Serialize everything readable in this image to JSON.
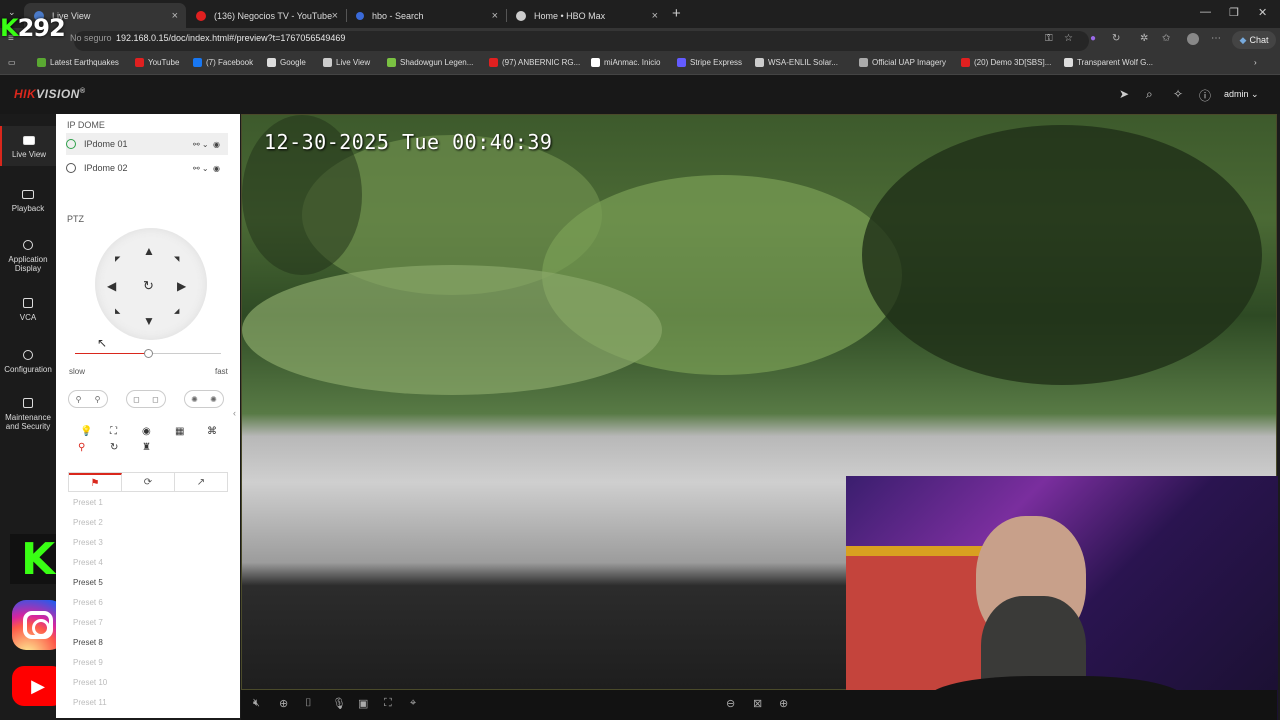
{
  "browser": {
    "tabs": [
      {
        "label": "Live View",
        "active": true,
        "color": "#4a7ac8"
      },
      {
        "label": "(136) Negocios TV - YouTube",
        "active": false,
        "color": "#e02020"
      },
      {
        "label": "hbo - Search",
        "active": false,
        "color": "#3a6ad8"
      },
      {
        "label": "Home • HBO Max",
        "active": false,
        "color": "#cccccc"
      }
    ],
    "insecure_label": "No seguro",
    "url": "192.168.0.15/doc/index.html#/preview?t=1767056549469",
    "chat_label": "Chat",
    "bookmarks": [
      {
        "label": "Latest Earthquakes",
        "color": "#5aa832"
      },
      {
        "label": "YouTube",
        "color": "#e02020"
      },
      {
        "label": "(7) Facebook",
        "color": "#1877f2"
      },
      {
        "label": "Google",
        "color": "#dddddd"
      },
      {
        "label": "Live View",
        "color": "#cccccc"
      },
      {
        "label": "Shadowgun Legen...",
        "color": "#7ac142"
      },
      {
        "label": "(97) ANBERNIC RG...",
        "color": "#e02020"
      },
      {
        "label": "miAnmac. Inicio",
        "color": "#ffffff"
      },
      {
        "label": "Stripe Express",
        "color": "#635bff"
      },
      {
        "label": "WSA-ENLIL Solar...",
        "color": "#cccccc"
      },
      {
        "label": "Official UAP Imagery",
        "color": "#aaaaaa"
      },
      {
        "label": "(20) Demo 3D[SBS]...",
        "color": "#e02020"
      },
      {
        "label": "Transparent Wolf G...",
        "color": "#dddddd"
      }
    ]
  },
  "overlay": {
    "counter_k": "K",
    "counter_num": "292"
  },
  "app": {
    "logo_hk": "HIK",
    "logo_vs": "VISION",
    "logo_r": "®",
    "user": "admin",
    "nav": [
      {
        "label": "Live View",
        "active": true
      },
      {
        "label": "Playback",
        "active": false
      },
      {
        "label": "Application Display",
        "active": false
      },
      {
        "label": "VCA",
        "active": false
      },
      {
        "label": "Configuration",
        "active": false
      },
      {
        "label": "Maintenance and Security",
        "active": false
      }
    ],
    "group_title": "IP DOME",
    "cameras": [
      "IPdome 01",
      "IPdome 02"
    ],
    "ptz_title": "PTZ",
    "speed_slow": "slow",
    "speed_fast": "fast",
    "speed_value": 0.5,
    "presets": [
      {
        "label": "Preset 1",
        "set": false
      },
      {
        "label": "Preset 2",
        "set": false
      },
      {
        "label": "Preset 3",
        "set": false
      },
      {
        "label": "Preset 4",
        "set": false
      },
      {
        "label": "Preset 5",
        "set": true
      },
      {
        "label": "Preset 6",
        "set": false
      },
      {
        "label": "Preset 7",
        "set": false
      },
      {
        "label": "Preset 8",
        "set": true
      },
      {
        "label": "Preset 9",
        "set": false
      },
      {
        "label": "Preset 10",
        "set": false
      },
      {
        "label": "Preset 11",
        "set": false
      }
    ],
    "osd_timestamp": "12-30-2025 Tue 00:40:39"
  },
  "icons": {
    "tab_close": "×",
    "new_tab": "+",
    "up": "▲",
    "down": "▼",
    "left": "◀",
    "right": "▶",
    "diag": "◤",
    "reset": "↻",
    "ig": "instagram-icon",
    "yt": "▶"
  }
}
